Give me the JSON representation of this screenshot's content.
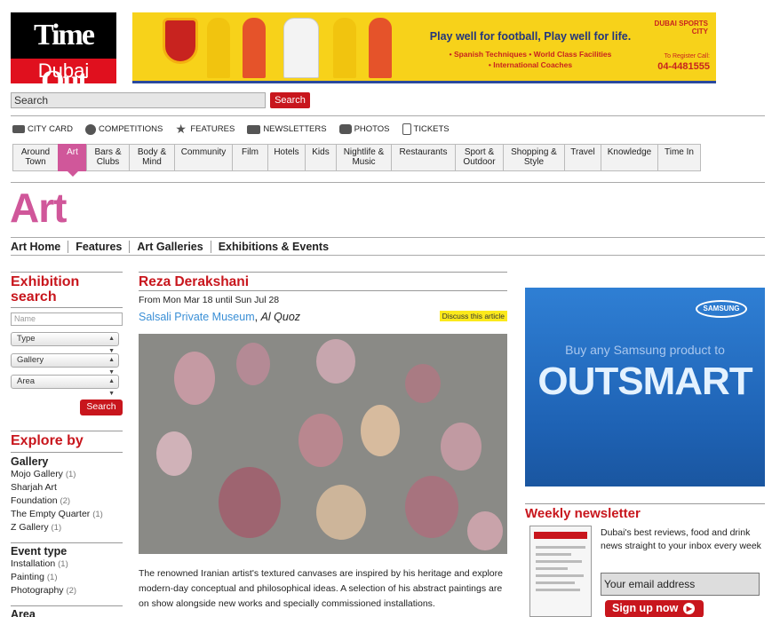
{
  "header": {
    "logo_top": "Time Out",
    "logo_bottom": "Dubai"
  },
  "banner": {
    "tagline": "Play well for football, Play well for life.",
    "bullet_1": "• Spanish Techniques   • World Class Facilities",
    "bullet_2": "• International Coaches",
    "brand": "DUBAI SPORTS CITY",
    "register_label": "To Register Call:",
    "phone": "04-4481555"
  },
  "search": {
    "value": "Search",
    "button_label": "Search"
  },
  "utility_nav": [
    {
      "label": "CITY CARD",
      "icon": "card-icon"
    },
    {
      "label": "COMPETITIONS",
      "icon": "trophy-icon"
    },
    {
      "label": "FEATURES",
      "icon": "star-icon"
    },
    {
      "label": "NEWSLETTERS",
      "icon": "envelope-icon"
    },
    {
      "label": "PHOTOS",
      "icon": "camera-icon"
    },
    {
      "label": "TICKETS",
      "icon": "ticket-icon"
    }
  ],
  "tabs": [
    {
      "line1": "Around",
      "line2": "Town"
    },
    {
      "line1": "Art",
      "line2": ""
    },
    {
      "line1": "Bars &",
      "line2": "Clubs"
    },
    {
      "line1": "Body &",
      "line2": "Mind"
    },
    {
      "line1": "Community",
      "line2": ""
    },
    {
      "line1": "Film",
      "line2": ""
    },
    {
      "line1": "Hotels",
      "line2": ""
    },
    {
      "line1": "Kids",
      "line2": ""
    },
    {
      "line1": "Nightlife &",
      "line2": "Music"
    },
    {
      "line1": "Restaurants",
      "line2": ""
    },
    {
      "line1": "Sport &",
      "line2": "Outdoor"
    },
    {
      "line1": "Shopping &",
      "line2": "Style"
    },
    {
      "line1": "Travel",
      "line2": ""
    },
    {
      "line1": "Knowledge",
      "line2": ""
    },
    {
      "line1": "Time In",
      "line2": ""
    }
  ],
  "section_title": "Art",
  "subnav": [
    "Art Home",
    "Features",
    "Art Galleries",
    "Exhibitions & Events"
  ],
  "exhibition_search": {
    "heading": "Exhibition search",
    "name_placeholder": "Name",
    "type_label": "Type",
    "gallery_label": "Gallery",
    "area_label": "Area",
    "button_label": "Search"
  },
  "explore": {
    "heading": "Explore by",
    "gallery_heading": "Gallery",
    "galleries": [
      {
        "name": "Mojo Gallery",
        "count": "(1)"
      },
      {
        "name": "Sharjah Art",
        "count": ""
      },
      {
        "name": "Foundation",
        "count": "(2)"
      },
      {
        "name": "The Empty Quarter",
        "count": "(1)"
      },
      {
        "name": "Z Gallery",
        "count": "(1)"
      }
    ],
    "event_heading": "Event type",
    "events": [
      {
        "name": "Installation",
        "count": "(1)"
      },
      {
        "name": "Painting",
        "count": "(1)"
      },
      {
        "name": "Photography",
        "count": "(2)"
      }
    ],
    "area_heading": "Area"
  },
  "article": {
    "title": "Reza Derakshani",
    "dates": "From Mon Mar 18 until Sun Jul 28",
    "venue": "Salsali Private Museum",
    "separator": ", ",
    "area": "Al Quoz",
    "discuss": "Discuss this article",
    "body": "The renowned Iranian artist's textured canvases are inspired by his heritage and explore modern-day conceptual and philosophical ideas. A selection of his abstract paintings are on show alongside new works and specially commissioned installations."
  },
  "ad": {
    "brand": "SAMSUNG",
    "line1": "Buy any Samsung product to",
    "line2": "OUTSMART"
  },
  "newsletter": {
    "heading": "Weekly newsletter",
    "text": "Dubai's best reviews, food and drink news straight to your inbox every week",
    "input_value": "Your email address",
    "button_label": "Sign up now"
  }
}
